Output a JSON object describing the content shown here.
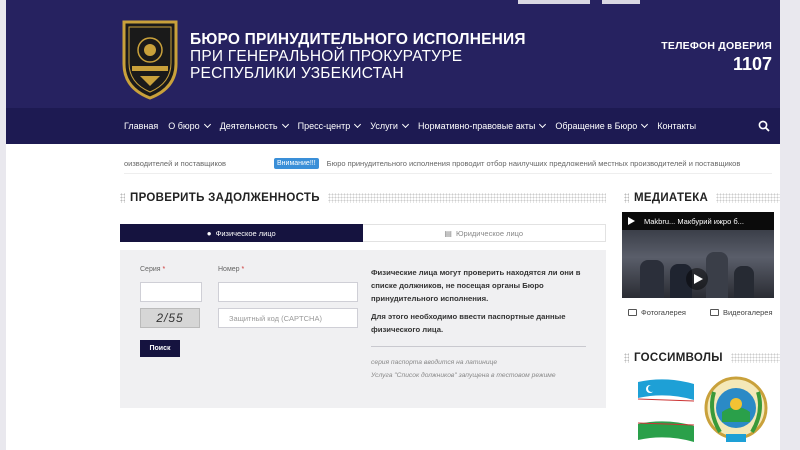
{
  "header": {
    "org_line1": "БЮРО ПРИНУДИТЕЛЬНОГО ИСПОЛНЕНИЯ",
    "org_line2": "ПРИ ГЕНЕРАЛЬНОЙ ПРОКУРАТУРЕ",
    "org_line3": "РЕСПУБЛИКИ УЗБЕКИСТАН",
    "trust_label": "ТЕЛЕФОН ДОВЕРИЯ",
    "trust_number": "1107"
  },
  "nav": {
    "items": [
      {
        "label": "Главная",
        "dropdown": false
      },
      {
        "label": "О бюро",
        "dropdown": true
      },
      {
        "label": "Деятельность",
        "dropdown": true
      },
      {
        "label": "Пресс-центр",
        "dropdown": true
      },
      {
        "label": "Услуги",
        "dropdown": true
      },
      {
        "label": "Нормативно-правовые акты",
        "dropdown": true
      },
      {
        "label": "Обращение в Бюро",
        "dropdown": true
      },
      {
        "label": "Контакты",
        "dropdown": false
      }
    ]
  },
  "ticker": {
    "left_text": "оизводителей и поставщиков",
    "badge": "Внимание!!!",
    "text": "Бюро принудительного исполнения проводит отбор наилучших предложений местных производителей и поставщиков"
  },
  "debt": {
    "title": "ПРОВЕРИТЬ ЗАДОЛЖЕННОСТЬ",
    "tab_individual": "Физическое лицо",
    "tab_legal": "Юридическое лицо",
    "series_label": "Серия",
    "number_label": "Номер",
    "captcha_placeholder": "Защитный код (CAPTCHA)",
    "captcha_text": "2/55",
    "search_button": "Поиск",
    "info_p1": "Физические лица могут проверить находятся ли они в списке должников, не посещая органы Бюро принудительного исполнения.",
    "info_p2": "Для этого необходимо ввести паспортные данные физического лица.",
    "note1": "серия паспорта вводится на латинице",
    "note2": "Услуга \"Список должников\" запущена в тестовом режиме"
  },
  "sidebar": {
    "media_title": "МЕДИАТЕКА",
    "video_title": "Makbru... Макбурий ижро б...",
    "photo_link": "Фотогалерея",
    "video_link": "Видеогалерея",
    "symbols_title": "ГОССИМВОЛЫ"
  },
  "colors": {
    "header_bg": "#262260",
    "nav_bg": "#1d1a52",
    "accent": "#15133f",
    "badge": "#3a8fd8"
  }
}
